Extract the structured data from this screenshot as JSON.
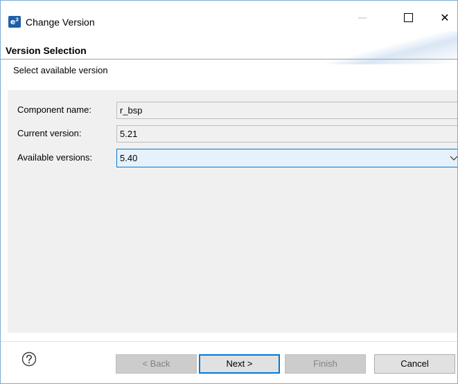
{
  "window": {
    "app_icon_label": "e",
    "app_icon_sup": "2",
    "title": "Change Version",
    "minimize_glyph": "—",
    "close_glyph": "✕"
  },
  "header": {
    "title": "Version Selection",
    "subtitle": "Select available version"
  },
  "form": {
    "component_name": {
      "label": "Component name:",
      "value": "r_bsp"
    },
    "current_version": {
      "label": "Current version:",
      "value": "5.21"
    },
    "available_versions": {
      "label": "Available versions:",
      "selected": "5.40"
    }
  },
  "buttons": {
    "back": "< Back",
    "next": "Next >",
    "finish": "Finish",
    "cancel": "Cancel"
  },
  "icons": {
    "app": "e2-studio-icon",
    "help": "help-icon",
    "dropdown": "chevron-down-icon"
  },
  "colors": {
    "accent": "#0078d7",
    "select_bg": "#e5f1fb",
    "content_bg": "#f0f0f0",
    "app_icon": "#1f5fa8"
  }
}
